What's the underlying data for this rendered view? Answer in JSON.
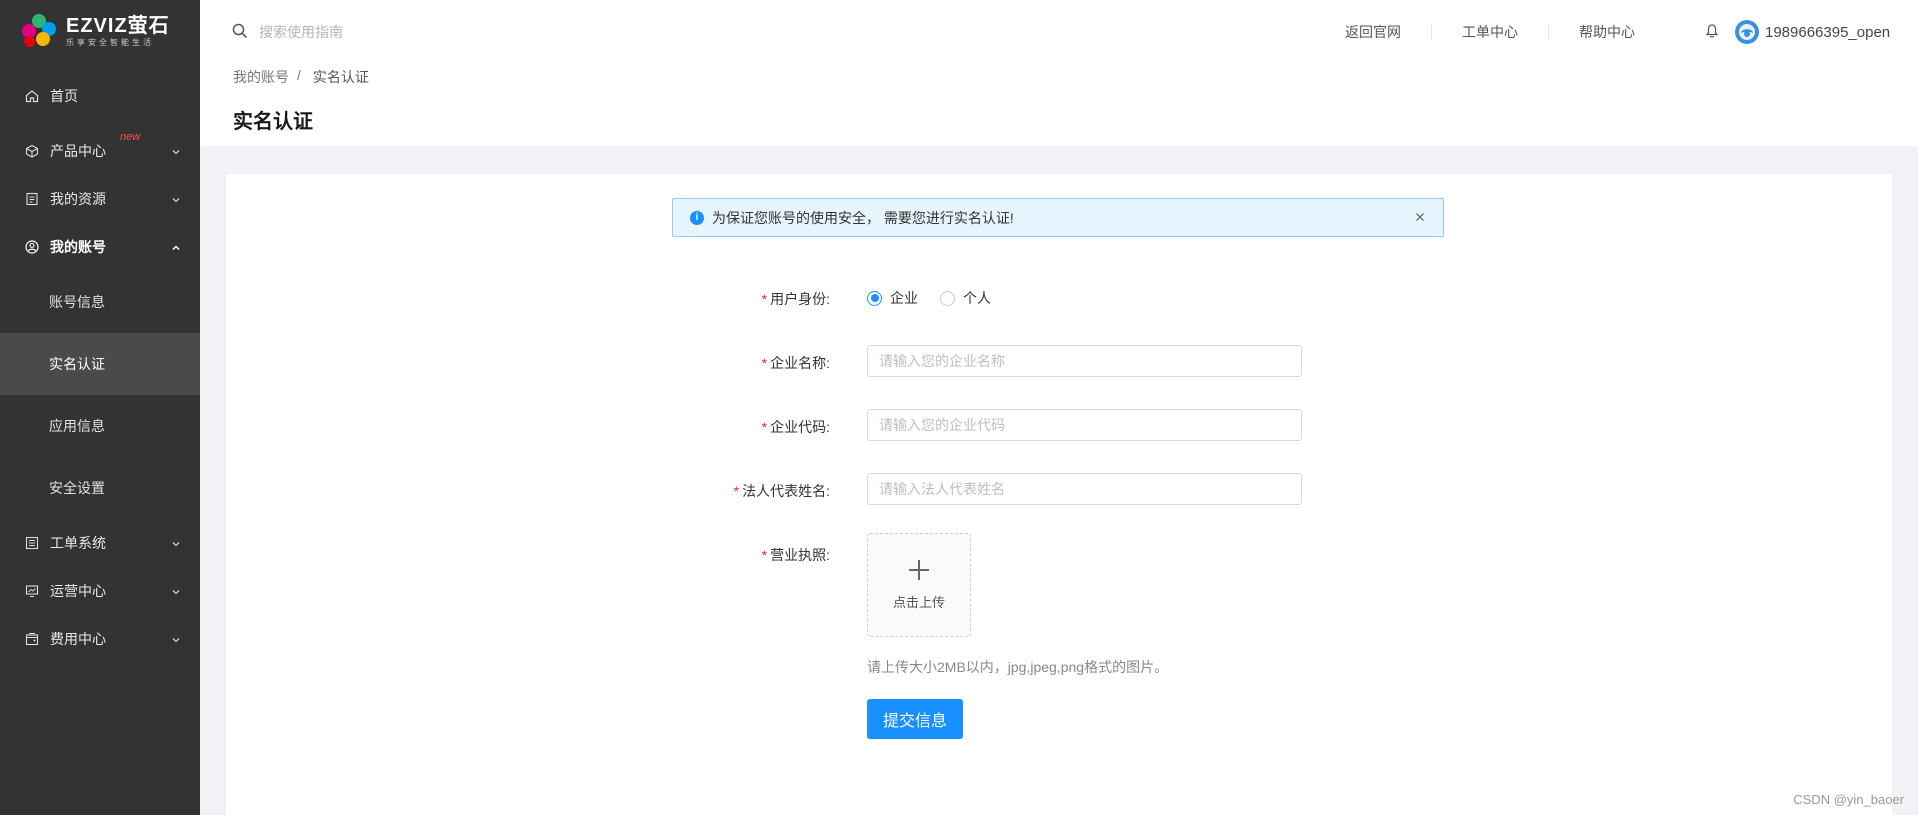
{
  "logo": {
    "brand": "EZVIZ萤石",
    "slogan": "乐享安全智能生活"
  },
  "sidebar": {
    "items": [
      {
        "label": "首页",
        "icon": "home-icon"
      },
      {
        "label": "产品中心",
        "badge": "new",
        "icon": "package-icon"
      },
      {
        "label": "我的资源",
        "icon": "document-icon"
      },
      {
        "label": "我的账号",
        "icon": "user-circle-icon"
      },
      {
        "label": "工单系统",
        "icon": "list-icon"
      },
      {
        "label": "运营中心",
        "icon": "monitor-chart-icon"
      },
      {
        "label": "费用中心",
        "icon": "wallet-icon"
      }
    ],
    "sub_items": [
      "账号信息",
      "实名认证",
      "应用信息",
      "安全设置"
    ]
  },
  "header": {
    "search_placeholder": "搜索使用指南",
    "links": [
      "返回官网",
      "工单中心",
      "帮助中心"
    ],
    "username": "1989666395_open"
  },
  "breadcrumb": {
    "parent": "我的账号",
    "separator": "/",
    "current": "实名认证"
  },
  "page_title": "实名认证",
  "alert": {
    "message": "为保证您账号的使用安全， 需要您进行实名认证!"
  },
  "form": {
    "identity": {
      "label": "用户身份:",
      "options": [
        "企业",
        "个人"
      ],
      "selected": "企业"
    },
    "company_name": {
      "label": "企业名称:",
      "placeholder": "请输入您的企业名称"
    },
    "company_code": {
      "label": "企业代码:",
      "placeholder": "请输入您的企业代码"
    },
    "legal_rep": {
      "label": "法人代表姓名:",
      "placeholder": "请输入法人代表姓名"
    },
    "license": {
      "label": "营业执照:",
      "upload_text": "点击上传",
      "hint": "请上传大小2MB以内，jpg,jpeg,png格式的图片。"
    },
    "required_mark": "*",
    "submit_label": "提交信息"
  },
  "watermark": "CSDN @yin_baoer",
  "colors": {
    "primary": "#1890ff",
    "sidebar_bg": "#333333",
    "required": "#f5222d",
    "alert_bg": "#e6f4fd"
  }
}
